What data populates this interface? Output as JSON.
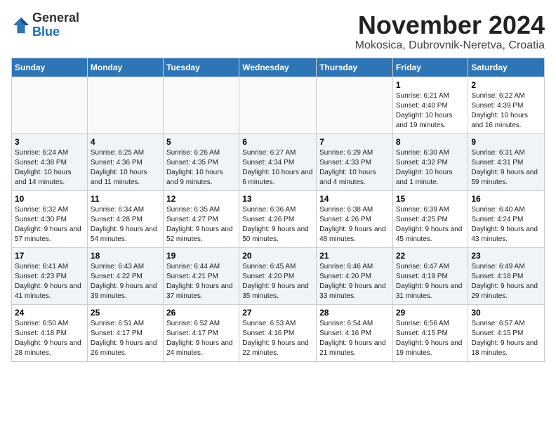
{
  "logo": {
    "general": "General",
    "blue": "Blue"
  },
  "header": {
    "month": "November 2024",
    "location": "Mokosica, Dubrovnik-Neretva, Croatia"
  },
  "weekdays": [
    "Sunday",
    "Monday",
    "Tuesday",
    "Wednesday",
    "Thursday",
    "Friday",
    "Saturday"
  ],
  "weeks": [
    [
      {
        "day": "",
        "info": ""
      },
      {
        "day": "",
        "info": ""
      },
      {
        "day": "",
        "info": ""
      },
      {
        "day": "",
        "info": ""
      },
      {
        "day": "",
        "info": ""
      },
      {
        "day": "1",
        "info": "Sunrise: 6:21 AM\nSunset: 4:40 PM\nDaylight: 10 hours and 19 minutes."
      },
      {
        "day": "2",
        "info": "Sunrise: 6:22 AM\nSunset: 4:39 PM\nDaylight: 10 hours and 16 minutes."
      }
    ],
    [
      {
        "day": "3",
        "info": "Sunrise: 6:24 AM\nSunset: 4:38 PM\nDaylight: 10 hours and 14 minutes."
      },
      {
        "day": "4",
        "info": "Sunrise: 6:25 AM\nSunset: 4:36 PM\nDaylight: 10 hours and 11 minutes."
      },
      {
        "day": "5",
        "info": "Sunrise: 6:26 AM\nSunset: 4:35 PM\nDaylight: 10 hours and 9 minutes."
      },
      {
        "day": "6",
        "info": "Sunrise: 6:27 AM\nSunset: 4:34 PM\nDaylight: 10 hours and 6 minutes."
      },
      {
        "day": "7",
        "info": "Sunrise: 6:29 AM\nSunset: 4:33 PM\nDaylight: 10 hours and 4 minutes."
      },
      {
        "day": "8",
        "info": "Sunrise: 6:30 AM\nSunset: 4:32 PM\nDaylight: 10 hours and 1 minute."
      },
      {
        "day": "9",
        "info": "Sunrise: 6:31 AM\nSunset: 4:31 PM\nDaylight: 9 hours and 59 minutes."
      }
    ],
    [
      {
        "day": "10",
        "info": "Sunrise: 6:32 AM\nSunset: 4:30 PM\nDaylight: 9 hours and 57 minutes."
      },
      {
        "day": "11",
        "info": "Sunrise: 6:34 AM\nSunset: 4:28 PM\nDaylight: 9 hours and 54 minutes."
      },
      {
        "day": "12",
        "info": "Sunrise: 6:35 AM\nSunset: 4:27 PM\nDaylight: 9 hours and 52 minutes."
      },
      {
        "day": "13",
        "info": "Sunrise: 6:36 AM\nSunset: 4:26 PM\nDaylight: 9 hours and 50 minutes."
      },
      {
        "day": "14",
        "info": "Sunrise: 6:38 AM\nSunset: 4:26 PM\nDaylight: 9 hours and 48 minutes."
      },
      {
        "day": "15",
        "info": "Sunrise: 6:39 AM\nSunset: 4:25 PM\nDaylight: 9 hours and 45 minutes."
      },
      {
        "day": "16",
        "info": "Sunrise: 6:40 AM\nSunset: 4:24 PM\nDaylight: 9 hours and 43 minutes."
      }
    ],
    [
      {
        "day": "17",
        "info": "Sunrise: 6:41 AM\nSunset: 4:23 PM\nDaylight: 9 hours and 41 minutes."
      },
      {
        "day": "18",
        "info": "Sunrise: 6:43 AM\nSunset: 4:22 PM\nDaylight: 9 hours and 39 minutes."
      },
      {
        "day": "19",
        "info": "Sunrise: 6:44 AM\nSunset: 4:21 PM\nDaylight: 9 hours and 37 minutes."
      },
      {
        "day": "20",
        "info": "Sunrise: 6:45 AM\nSunset: 4:20 PM\nDaylight: 9 hours and 35 minutes."
      },
      {
        "day": "21",
        "info": "Sunrise: 6:46 AM\nSunset: 4:20 PM\nDaylight: 9 hours and 33 minutes."
      },
      {
        "day": "22",
        "info": "Sunrise: 6:47 AM\nSunset: 4:19 PM\nDaylight: 9 hours and 31 minutes."
      },
      {
        "day": "23",
        "info": "Sunrise: 6:49 AM\nSunset: 4:18 PM\nDaylight: 9 hours and 29 minutes."
      }
    ],
    [
      {
        "day": "24",
        "info": "Sunrise: 6:50 AM\nSunset: 4:18 PM\nDaylight: 9 hours and 28 minutes."
      },
      {
        "day": "25",
        "info": "Sunrise: 6:51 AM\nSunset: 4:17 PM\nDaylight: 9 hours and 26 minutes."
      },
      {
        "day": "26",
        "info": "Sunrise: 6:52 AM\nSunset: 4:17 PM\nDaylight: 9 hours and 24 minutes."
      },
      {
        "day": "27",
        "info": "Sunrise: 6:53 AM\nSunset: 4:16 PM\nDaylight: 9 hours and 22 minutes."
      },
      {
        "day": "28",
        "info": "Sunrise: 6:54 AM\nSunset: 4:16 PM\nDaylight: 9 hours and 21 minutes."
      },
      {
        "day": "29",
        "info": "Sunrise: 6:56 AM\nSunset: 4:15 PM\nDaylight: 9 hours and 19 minutes."
      },
      {
        "day": "30",
        "info": "Sunrise: 6:57 AM\nSunset: 4:15 PM\nDaylight: 9 hours and 18 minutes."
      }
    ]
  ]
}
